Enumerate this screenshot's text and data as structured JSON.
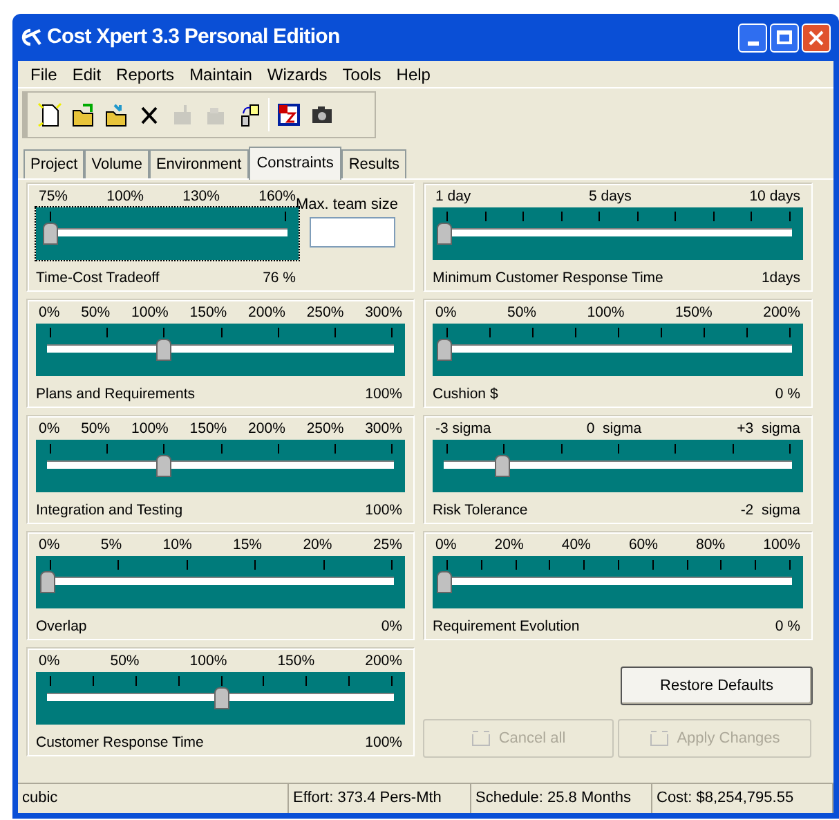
{
  "window": {
    "title": "Cost Xpert 3.3 Personal Edition"
  },
  "menu": [
    "File",
    "Edit",
    "Reports",
    "Maintain",
    "Wizards",
    "Tools",
    "Help"
  ],
  "toolbar": [
    {
      "kind": "new",
      "disabled": false
    },
    {
      "kind": "open",
      "disabled": false
    },
    {
      "kind": "open2",
      "disabled": false
    },
    {
      "kind": "delete",
      "disabled": false
    },
    {
      "kind": "gray1",
      "disabled": true
    },
    {
      "kind": "gray2",
      "disabled": true
    },
    {
      "kind": "copy",
      "disabled": false
    },
    {
      "kind": "sep"
    },
    {
      "kind": "calendar",
      "disabled": false
    },
    {
      "kind": "camera",
      "disabled": false
    }
  ],
  "tabs": [
    {
      "label": "Project",
      "selected": false
    },
    {
      "label": "Volume",
      "selected": false
    },
    {
      "label": "Environment",
      "selected": false
    },
    {
      "label": "Constraints",
      "selected": true
    },
    {
      "label": "Results",
      "selected": false
    }
  ],
  "left_sliders": [
    {
      "scale": [
        "75%",
        "100%",
        "130%",
        "160%"
      ],
      "label": "Time-Cost Tradeoff",
      "value": "76 %",
      "level": 0.01,
      "team_size": {
        "label": "Max. team size"
      }
    },
    {
      "scale": [
        "0%",
        "50%",
        "100%",
        "150%",
        "200%",
        "250%",
        "300%"
      ],
      "label": "Plans and Requirements",
      "value": "100%",
      "level": 0.333
    },
    {
      "scale": [
        "0%",
        "50%",
        "100%",
        "150%",
        "200%",
        "250%",
        "300%"
      ],
      "label": "Integration and Testing",
      "value": "100%",
      "level": 0.333
    },
    {
      "scale": [
        "0%",
        "5%",
        "10%",
        "15%",
        "20%",
        "25%"
      ],
      "label": "Overlap",
      "value": "0%",
      "level": 0
    },
    {
      "scale": [
        "0%",
        "50%",
        "100%",
        "150%",
        "200%"
      ],
      "label": "Customer Response Time",
      "value": "100%",
      "level": 0.5
    }
  ],
  "right_sliders": [
    {
      "scale": [
        "1 day",
        "5 days",
        "10 days"
      ],
      "label": "Minimum Customer Response Time",
      "value": "1days",
      "level": 0
    },
    {
      "scale": [
        "0%",
        "50%",
        "100%",
        "150%",
        "200%"
      ],
      "label": "Cushion $",
      "value": "0 %",
      "level": 0
    },
    {
      "scale": [
        "-3 sigma",
        "0  sigma",
        "+3  sigma"
      ],
      "label": "Risk Tolerance",
      "value": "-2  sigma",
      "level": 0.167
    },
    {
      "scale": [
        "0%",
        "20%",
        "40%",
        "60%",
        "80%",
        "100%"
      ],
      "label": "Requirement Evolution",
      "value": "0 %",
      "level": 0
    }
  ],
  "buttons": [
    {
      "label": "Restore Defaults",
      "disabled": false
    },
    {
      "label": "Cancel all",
      "disabled": true
    },
    {
      "label": "Apply Changes",
      "disabled": true
    }
  ],
  "status_bar": [
    "cubic",
    "Effort: 373.4 Pers-Mth",
    "Schedule: 25.8 Months",
    "Cost: $8,254,795.55"
  ]
}
